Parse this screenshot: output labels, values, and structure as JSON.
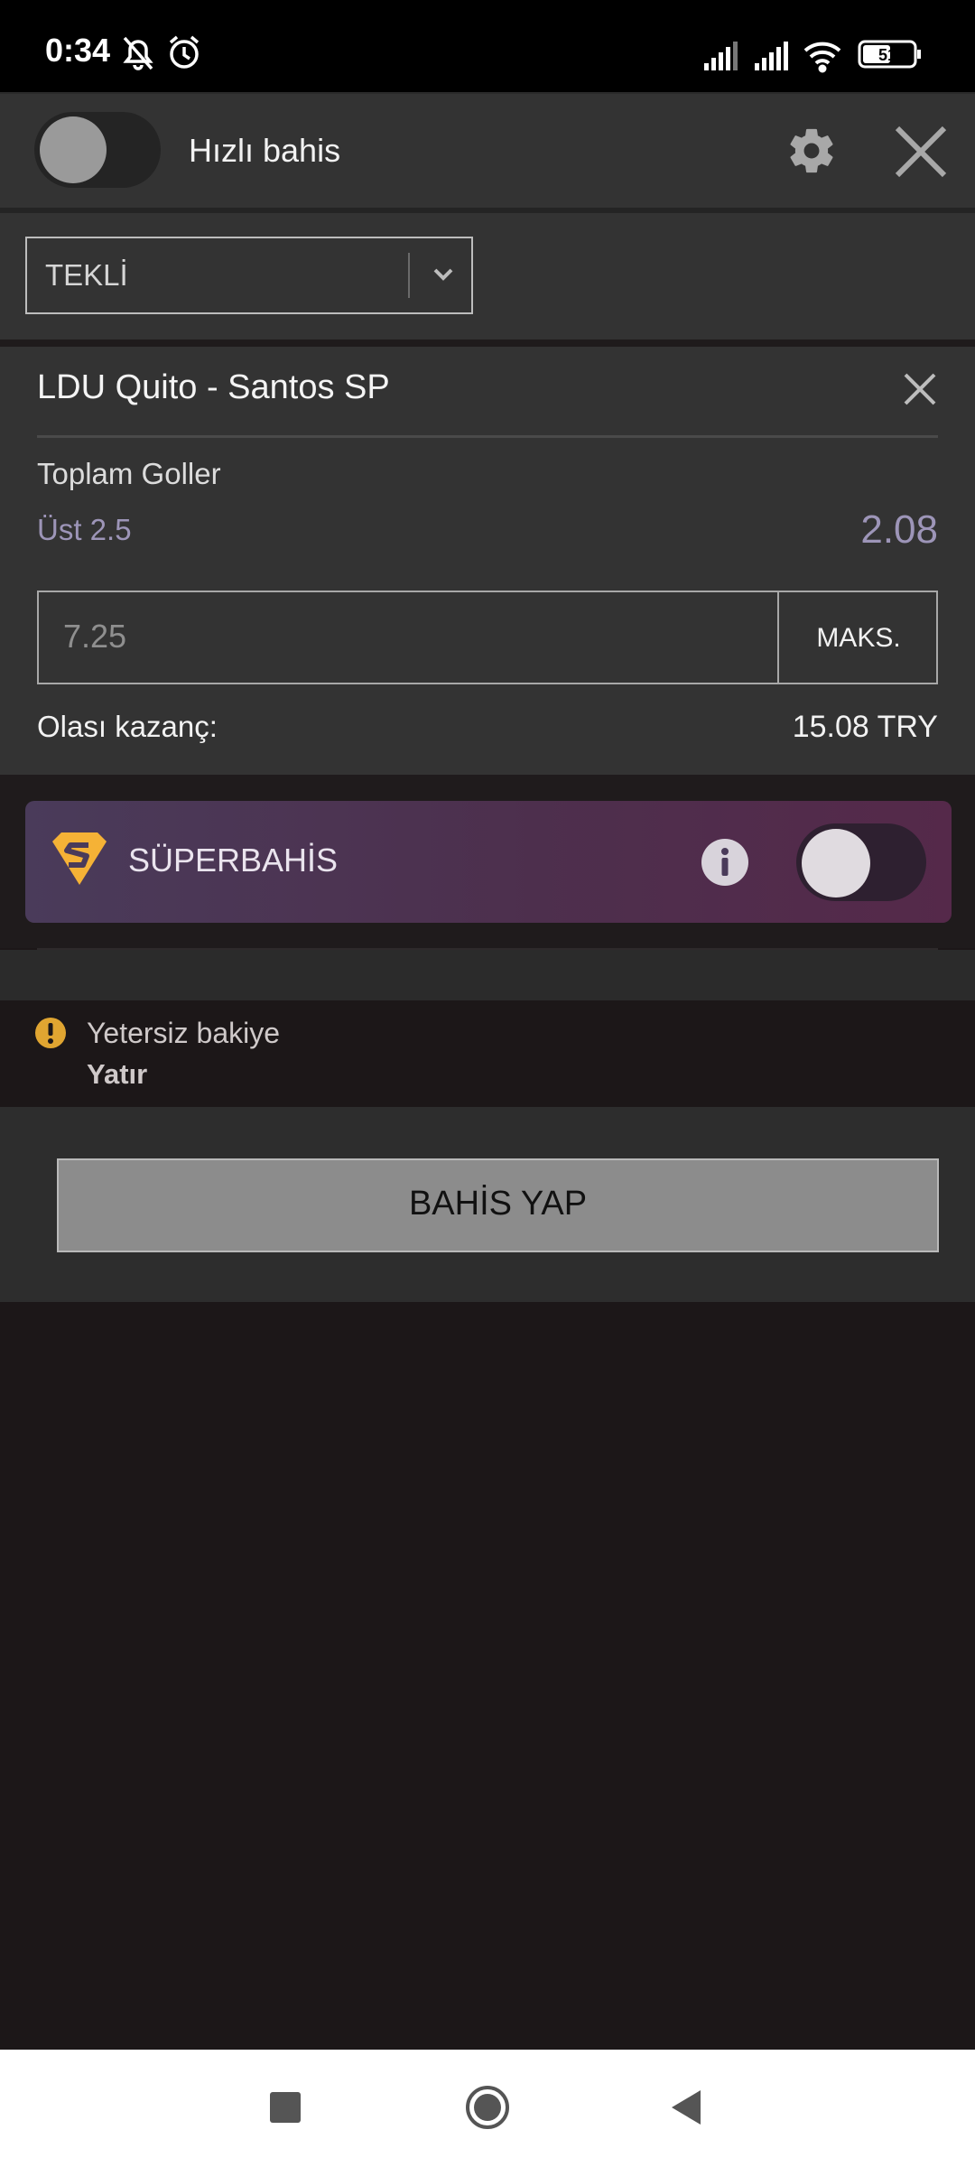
{
  "status_bar": {
    "time": "0:34",
    "battery": "51",
    "icons": [
      "bell-off-icon",
      "alarm-icon",
      "signal-icon",
      "signal-icon",
      "wifi-icon",
      "battery-icon"
    ]
  },
  "header": {
    "quick_bet_label": "Hızlı bahis",
    "quick_bet_enabled": false,
    "settings_icon": "gear-icon",
    "close_icon": "close-icon"
  },
  "bet_type": {
    "selected": "TEKLİ"
  },
  "bet_slip": {
    "match": "LDU Quito - Santos SP",
    "market": "Toplam Goller",
    "selection": "Üst 2.5",
    "odds": "2.08",
    "stake_placeholder": "7.25",
    "max_label": "MAKS.",
    "payout_label": "Olası kazanç:",
    "payout_value": "15.08 TRY"
  },
  "super_bet": {
    "label": "SÜPERBAHİS",
    "enabled": false
  },
  "warning": {
    "text": "Yetersiz bakiye",
    "action": "Yatır"
  },
  "place_bet": {
    "label": "BAHİS YAP"
  },
  "colors": {
    "panel": "#333333",
    "background": "#1c1718",
    "accent_gold": "#f5b236",
    "odds_text": "#9d95b8",
    "button_gray": "#8c8c8c"
  }
}
